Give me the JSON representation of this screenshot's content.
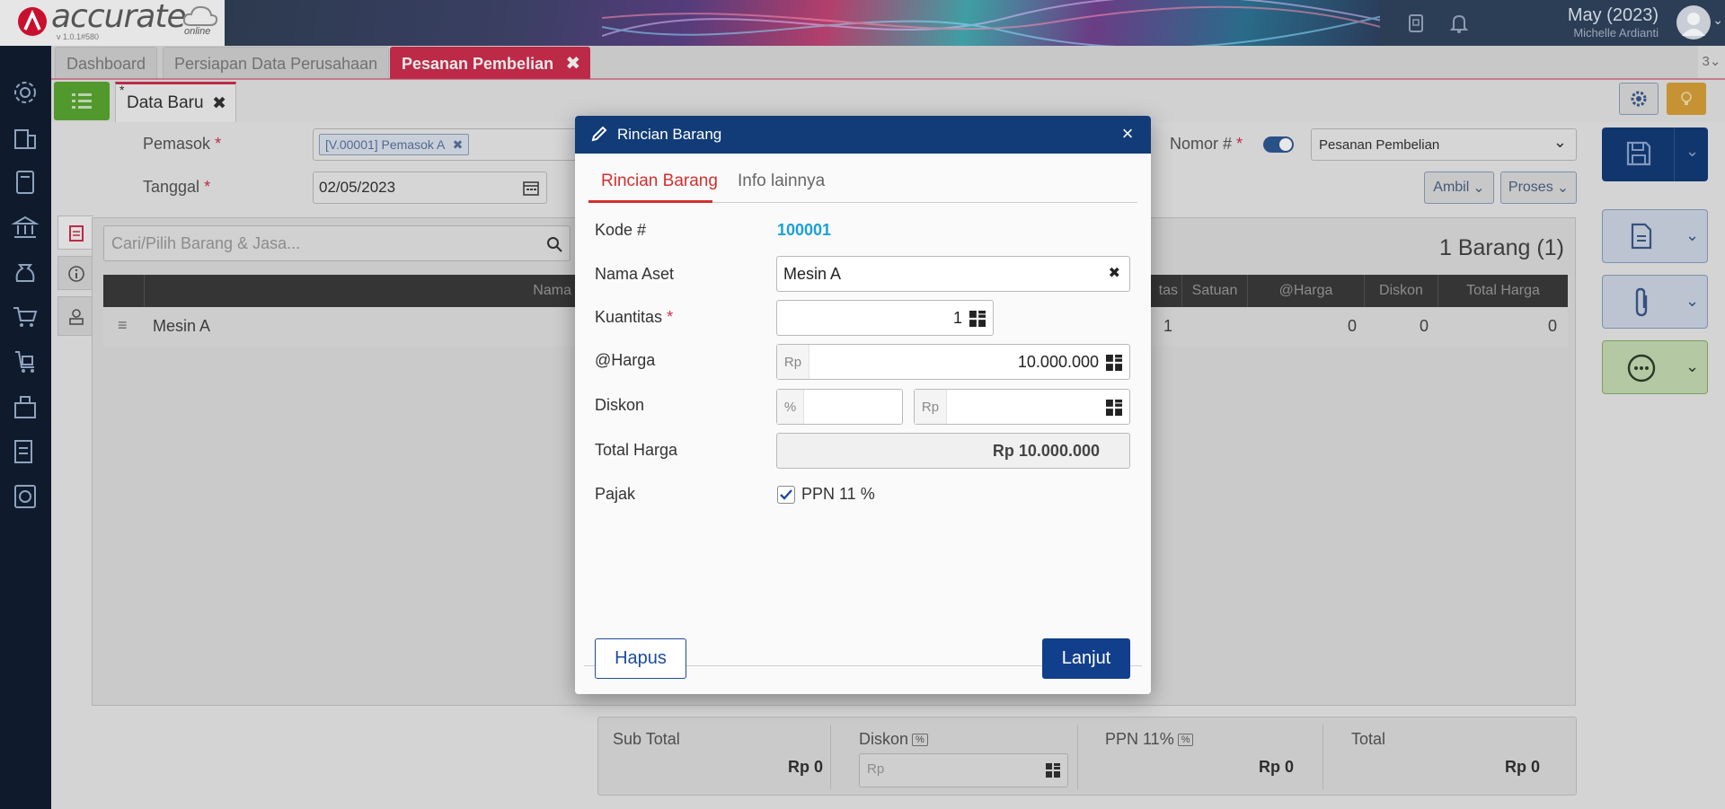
{
  "header": {
    "brand": "accurate",
    "brand_sub": "online",
    "version": "v 1.0.1#580",
    "period": "May (2023)",
    "user_name": "Michelle Ardianti"
  },
  "tabs": [
    {
      "label": "Dashboard"
    },
    {
      "label": "Persiapan Data Perusahaan"
    },
    {
      "label": "Pesanan Pembelian"
    }
  ],
  "tab_count": "3",
  "subtab": {
    "label": "Data Baru",
    "marker": "*"
  },
  "form": {
    "pemasok_label": "Pemasok",
    "pemasok_value": "[V.00001] Pemasok A",
    "tanggal_label": "Tanggal",
    "tanggal_value": "02/05/2023",
    "nomor_label": "Nomor #",
    "nomor_type": "Pesanan Pembelian",
    "ambil_label": "Ambil",
    "proses_label": "Proses",
    "search_placeholder": "Cari/Pilih Barang & Jasa...",
    "item_count": "1 Barang (1)"
  },
  "table": {
    "headers": [
      "Nama Barang",
      "tas",
      "Satuan",
      "@Harga",
      "Diskon",
      "Total Harga"
    ],
    "rows": [
      {
        "name": "Mesin A",
        "qty": "1",
        "unit": "",
        "price": "0",
        "discount": "0",
        "total": "0"
      }
    ]
  },
  "footer": {
    "subtotal_label": "Sub Total",
    "subtotal_value": "Rp 0",
    "diskon_label": "Diskon",
    "diskon_badge": "%",
    "diskon_placeholder": "Rp",
    "ppn_label": "PPN 11%",
    "ppn_badge": "%",
    "ppn_value": "Rp 0",
    "total_label": "Total",
    "total_value": "Rp 0"
  },
  "modal": {
    "title": "Rincian Barang",
    "tabs": [
      "Rincian Barang",
      "Info lainnya"
    ],
    "kode_label": "Kode #",
    "kode_value": "100001",
    "nama_label": "Nama Aset",
    "nama_value": "Mesin A",
    "qty_label": "Kuantitas",
    "qty_value": "1",
    "harga_label": "@Harga",
    "harga_prefix": "Rp",
    "harga_value": "10.000.000",
    "diskon_label": "Diskon",
    "diskon_pct_prefix": "%",
    "diskon_rp_prefix": "Rp",
    "total_label": "Total Harga",
    "total_value": "Rp 10.000.000",
    "pajak_label": "Pajak",
    "pajak_value": "PPN 11 %",
    "hapus_label": "Hapus",
    "lanjut_label": "Lanjut"
  },
  "colors": {
    "accent": "#cf2f4f",
    "modal_header": "#123c78",
    "primary_button": "#123f8c",
    "link": "#1ba1d6"
  }
}
